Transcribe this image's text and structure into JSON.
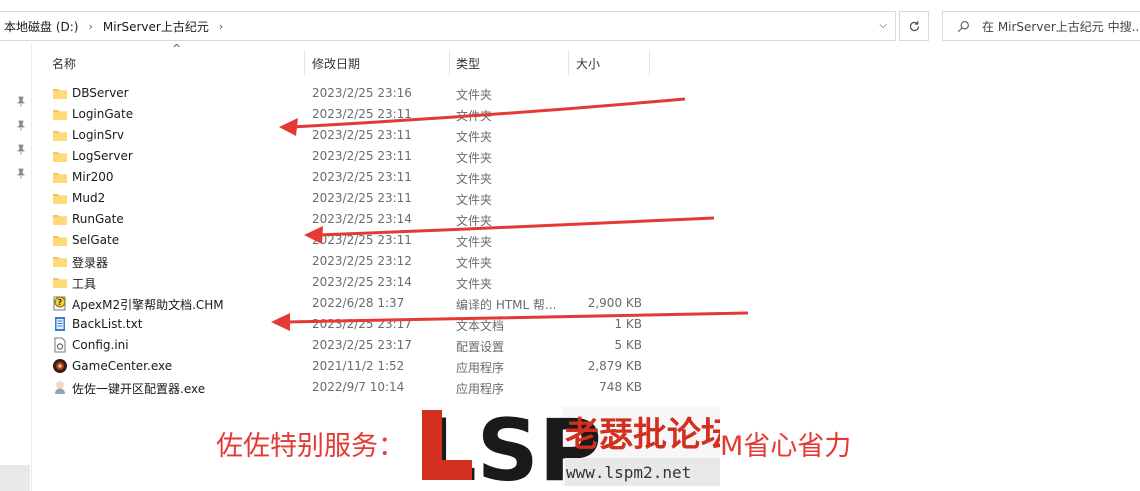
{
  "address": {
    "crumbs": [
      "本地磁盘 (D:)",
      "MirServer上古纪元"
    ],
    "search_placeholder": "在 MirServer上古纪元 中搜..."
  },
  "columns": {
    "name": "名称",
    "date": "修改日期",
    "type": "类型",
    "size": "大小"
  },
  "files": [
    {
      "name": "DBServer",
      "date": "2023/2/25 23:16",
      "type": "文件夹",
      "size": "",
      "icon": "folder-icon"
    },
    {
      "name": "LoginGate",
      "date": "2023/2/25 23:11",
      "type": "文件夹",
      "size": "",
      "icon": "folder-icon"
    },
    {
      "name": "LoginSrv",
      "date": "2023/2/25 23:11",
      "type": "文件夹",
      "size": "",
      "icon": "folder-icon"
    },
    {
      "name": "LogServer",
      "date": "2023/2/25 23:11",
      "type": "文件夹",
      "size": "",
      "icon": "folder-icon"
    },
    {
      "name": "Mir200",
      "date": "2023/2/25 23:11",
      "type": "文件夹",
      "size": "",
      "icon": "folder-icon"
    },
    {
      "name": "Mud2",
      "date": "2023/2/25 23:11",
      "type": "文件夹",
      "size": "",
      "icon": "folder-icon"
    },
    {
      "name": "RunGate",
      "date": "2023/2/25 23:14",
      "type": "文件夹",
      "size": "",
      "icon": "folder-icon"
    },
    {
      "name": "SelGate",
      "date": "2023/2/25 23:11",
      "type": "文件夹",
      "size": "",
      "icon": "folder-icon"
    },
    {
      "name": "登录器",
      "date": "2023/2/25 23:12",
      "type": "文件夹",
      "size": "",
      "icon": "folder-icon"
    },
    {
      "name": "工具",
      "date": "2023/2/25 23:14",
      "type": "文件夹",
      "size": "",
      "icon": "folder-icon"
    },
    {
      "name": "ApexM2引擎帮助文档.CHM",
      "date": "2022/6/28 1:37",
      "type": "编译的 HTML 帮...",
      "size": "2,900 KB",
      "icon": "chm-help-icon"
    },
    {
      "name": "BackList.txt",
      "date": "2023/2/25 23:17",
      "type": "文本文档",
      "size": "1 KB",
      "icon": "text-file-icon"
    },
    {
      "name": "Config.ini",
      "date": "2023/2/25 23:17",
      "type": "配置设置",
      "size": "5 KB",
      "icon": "ini-file-icon"
    },
    {
      "name": "GameCenter.exe",
      "date": "2021/11/2 1:52",
      "type": "应用程序",
      "size": "2,879 KB",
      "icon": "gamecenter-app-icon"
    },
    {
      "name": "佐佐一键开区配置器.exe",
      "date": "2022/9/7 10:14",
      "type": "应用程序",
      "size": "748 KB",
      "icon": "character-app-icon"
    }
  ],
  "promo": {
    "left_text": "佐佐特别服务：",
    "right_text": "M省心省力"
  },
  "logo": {
    "letters": "LSP",
    "title": "老瑟批论坛",
    "url": "www.lspm2.net"
  },
  "colors": {
    "arrow": "#e53935",
    "folder": "#f3c45a",
    "promo": "#e53935",
    "logo_red": "#d32f1e"
  }
}
